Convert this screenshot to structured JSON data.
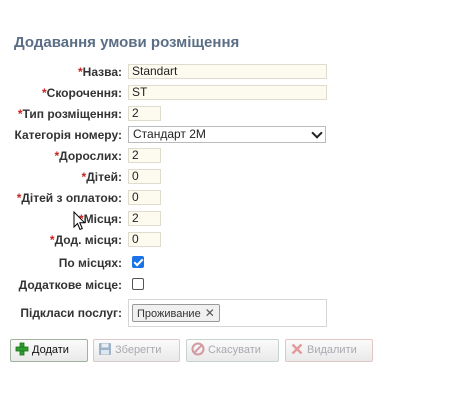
{
  "form": {
    "title": "Додавання умови розміщення",
    "fields": {
      "name": {
        "label": "Назва:",
        "value": "Standart"
      },
      "short": {
        "label": "Скорочення:",
        "value": "ST"
      },
      "type": {
        "label": "Тип розміщення:",
        "value": "2"
      },
      "category": {
        "label": "Категорія номеру:",
        "value": "Стандарт 2М"
      },
      "adults": {
        "label": "Дорослих:",
        "value": "2"
      },
      "children": {
        "label": "Дітей:",
        "value": "0"
      },
      "paid_children": {
        "label": "Дітей з оплатою:",
        "value": "0"
      },
      "places": {
        "label": "Місця:",
        "value": "2"
      },
      "extra_places": {
        "label": "Дод. місця:",
        "value": "0"
      },
      "by_places": {
        "label": "По місцях:",
        "checked": true
      },
      "extra_place": {
        "label": "Додаткове місце:",
        "checked": false
      },
      "subclasses": {
        "label": "Підкласи послуг:",
        "tags": [
          "Проживание"
        ]
      }
    },
    "required_mark": "*"
  },
  "buttons": {
    "add": "Додати",
    "save": "Зберегти",
    "cancel": "Скасувати",
    "delete": "Видалити"
  },
  "colors": {
    "title": "#5b6e85",
    "required": "#cc2020",
    "input_bg": "#fdfbf0",
    "checkbox_on": "#1a73e8"
  }
}
